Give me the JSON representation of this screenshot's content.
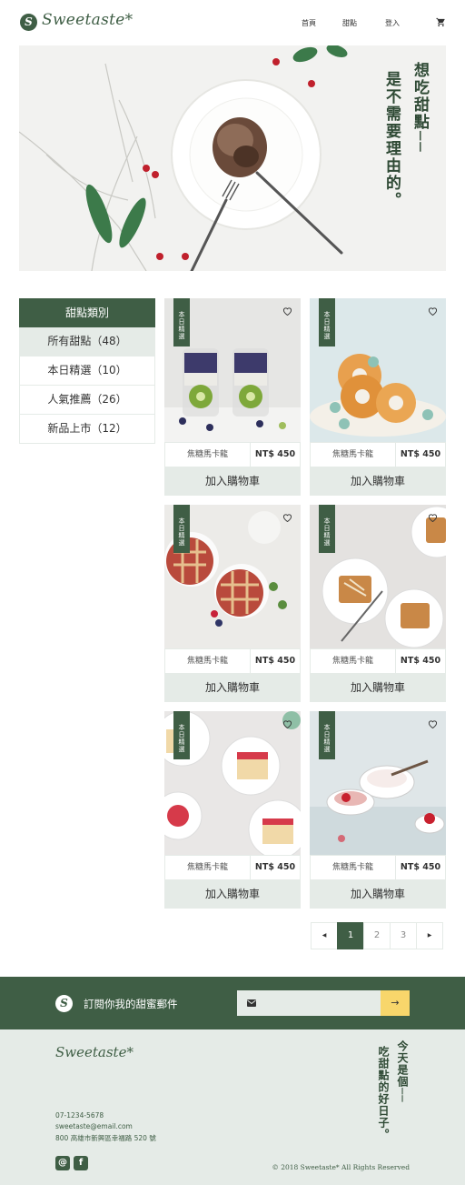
{
  "header": {
    "logo_mark": "S",
    "logo_text": "Sweetaste*",
    "nav": {
      "home": "首頁",
      "dessert": "甜點",
      "login": "登入"
    },
    "cart_icon": "cart-icon"
  },
  "hero": {
    "title_line1": "想吃甜點──",
    "title_line2": "是不需要理由的。"
  },
  "sidebar": {
    "heading": "甜點類別",
    "items": [
      {
        "label": "所有甜點（48）",
        "active": true
      },
      {
        "label": "本日精選（10）",
        "active": false
      },
      {
        "label": "人氣推薦（26）",
        "active": false
      },
      {
        "label": "新品上市（12）",
        "active": false
      }
    ]
  },
  "products": [
    {
      "badge": "本日精選",
      "name": "焦糖馬卡龍",
      "price": "NT$ 450",
      "button": "加入購物車"
    },
    {
      "badge": "本日精選",
      "name": "焦糖馬卡龍",
      "price": "NT$ 450",
      "button": "加入購物車"
    },
    {
      "badge": "本日精選",
      "name": "焦糖馬卡龍",
      "price": "NT$ 450",
      "button": "加入購物車"
    },
    {
      "badge": "本日精選",
      "name": "焦糖馬卡龍",
      "price": "NT$ 450",
      "button": "加入購物車"
    },
    {
      "badge": "本日精選",
      "name": "焦糖馬卡龍",
      "price": "NT$ 450",
      "button": "加入購物車"
    },
    {
      "badge": "本日精選",
      "name": "焦糖馬卡龍",
      "price": "NT$ 450",
      "button": "加入購物車"
    }
  ],
  "pagination": {
    "prev": "◀",
    "pages": [
      "1",
      "2",
      "3"
    ],
    "current": "1",
    "next": "▶"
  },
  "subscribe": {
    "logo_mark": "S",
    "text": "訂閱你我的甜蜜郵件",
    "button": "→"
  },
  "footer": {
    "logo": "Sweetaste*",
    "title_line1": "今天是個──",
    "title_line2": "吃甜點的好日子。",
    "phone": "07-1234-5678",
    "email": "sweetaste@email.com",
    "address": "800 高雄市新興區幸福路 520 號",
    "copyright": "© 2018 Sweetaste* All Rights Reserved"
  },
  "colors": {
    "brand_green": "#3f5e45",
    "light_green": "#e5ebe7",
    "accent_yellow": "#f8d66b"
  }
}
